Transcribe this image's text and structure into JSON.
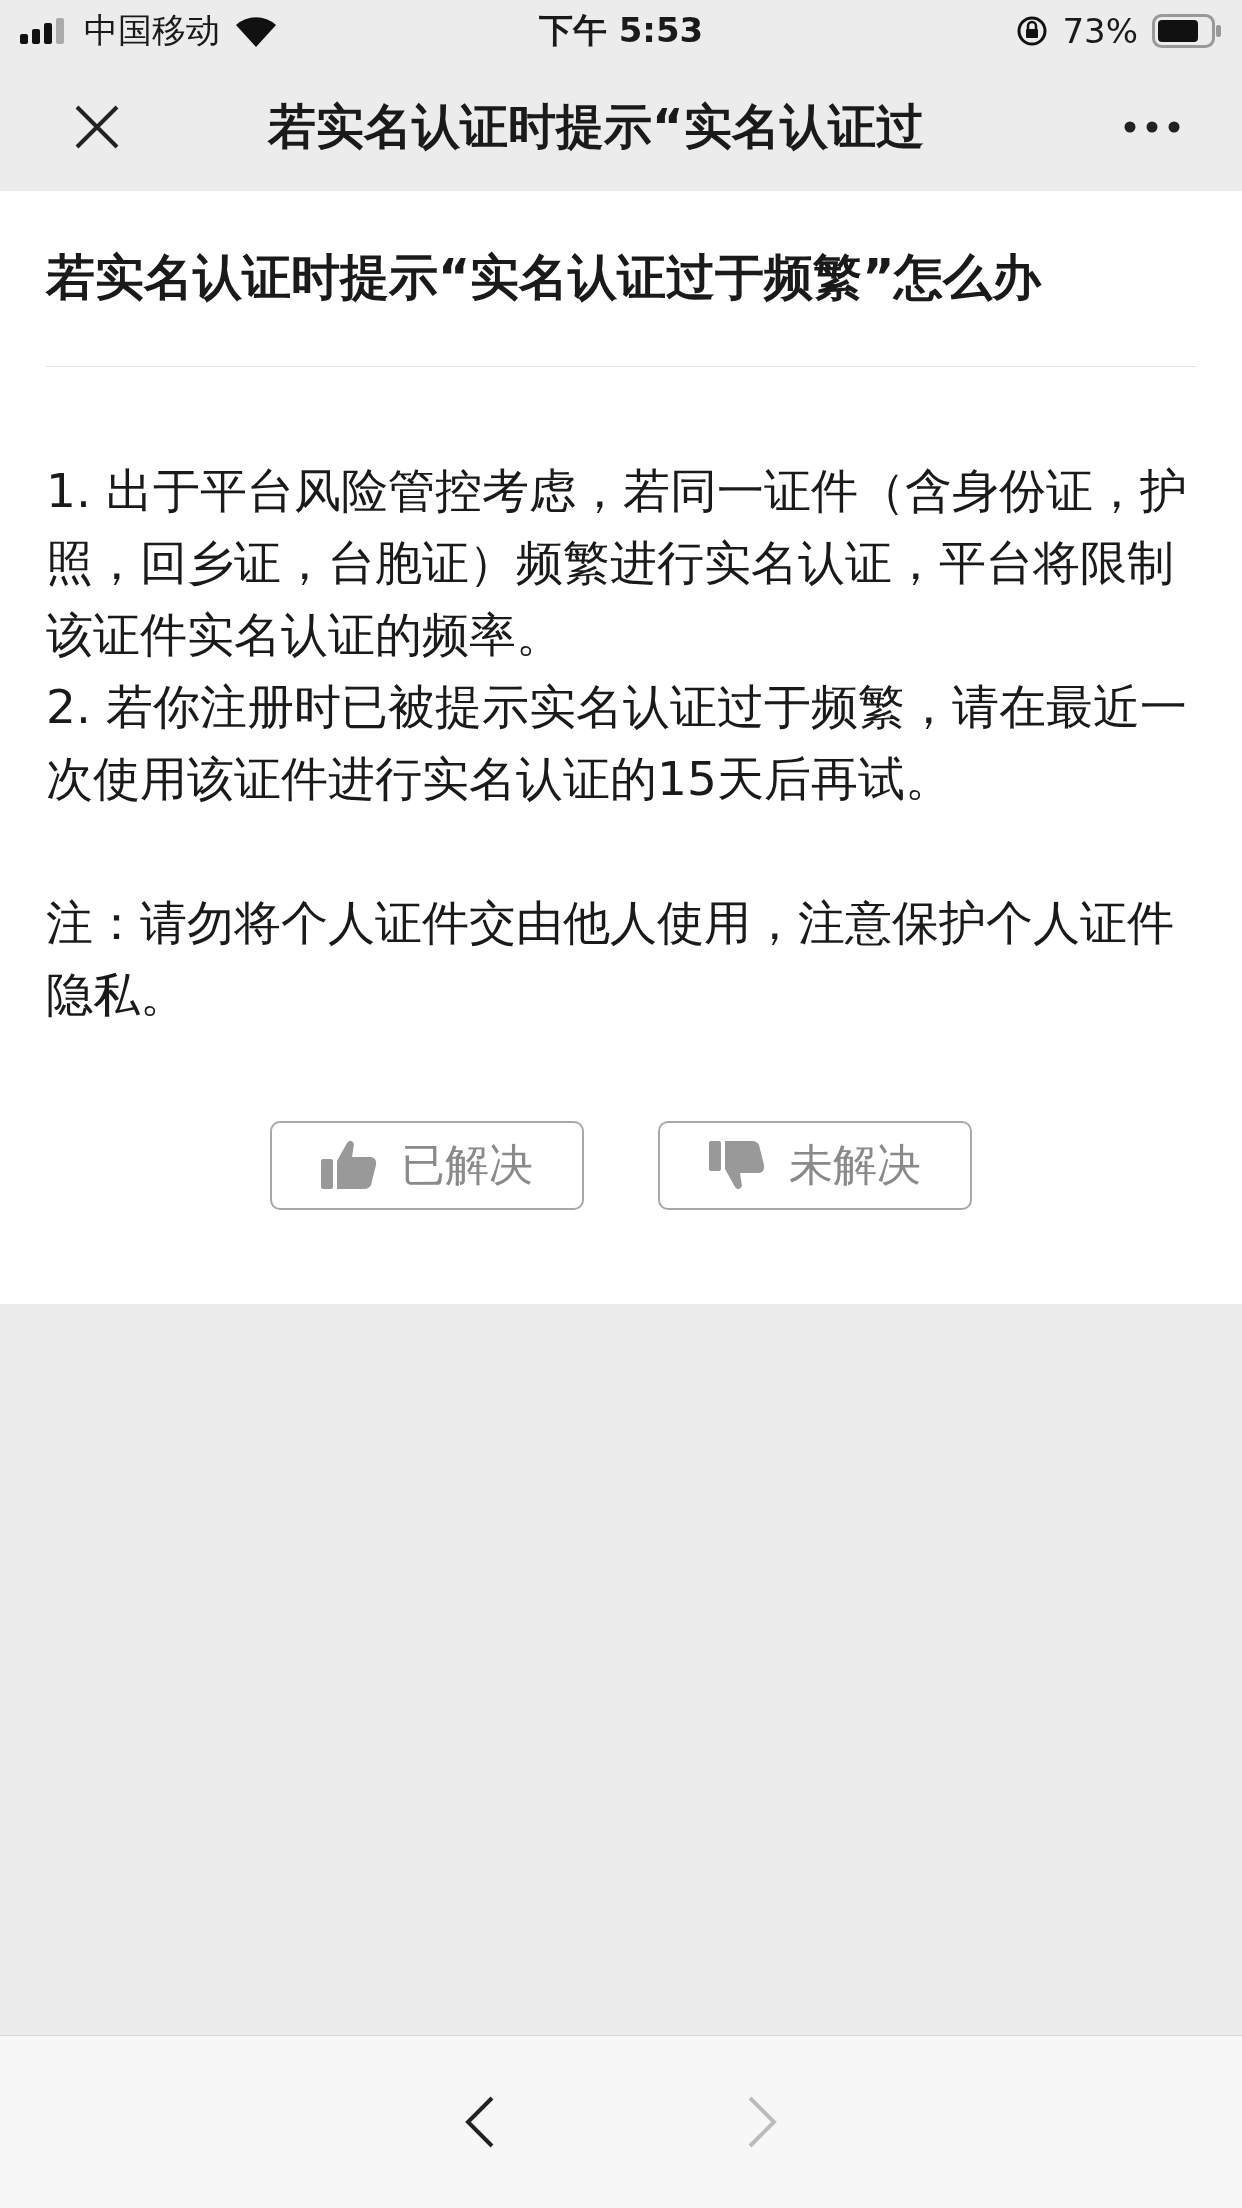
{
  "status_bar": {
    "carrier": "中国移动",
    "time": "下午 5:53",
    "battery": "73%"
  },
  "nav_bar": {
    "title": "若实名认证时提示“实名认证过"
  },
  "article": {
    "title": "若实名认证时提示“实名认证过于频繁”怎么办",
    "paragraphs": [
      "1. 出于平台风险管控考虑，若同一证件（含身份证，护照，回乡证，台胞证）频繁进行实名认证，平台将限制该证件实名认证的频率。",
      "2. 若你注册时已被提示实名认证过于频繁，请在最近一次使用该证件进行实名认证的15天后再试。"
    ],
    "note": "注：请勿将个人证件交由他人使用，注意保护个人证件隐私。"
  },
  "feedback": [
    {
      "kind": "up",
      "label": "已解决"
    },
    {
      "kind": "down",
      "label": "未解决"
    }
  ],
  "toolbar": {
    "back": {
      "disabled": false
    },
    "forward": {
      "disabled": true
    }
  }
}
